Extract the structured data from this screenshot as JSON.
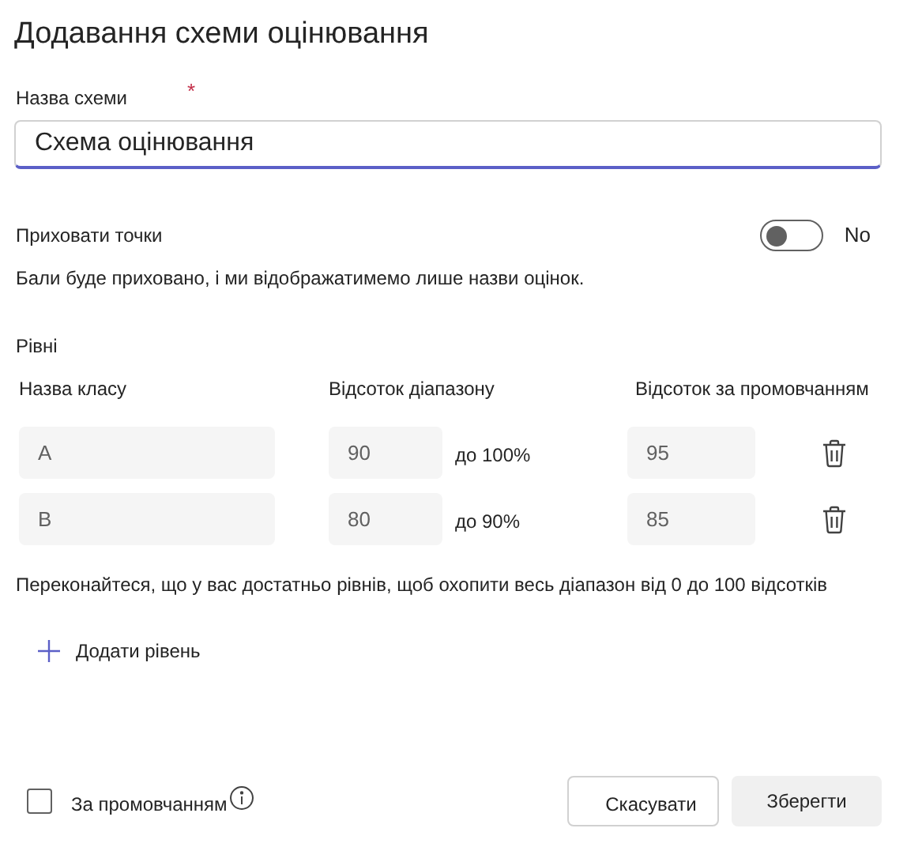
{
  "title": "Додавання схеми оцінювання",
  "scheme_name": {
    "label": "Назва схеми",
    "required_mark": "*",
    "value": "Схема оцінювання"
  },
  "hide_points": {
    "label": "Приховати точки",
    "on": false,
    "state_text": "No",
    "description": "Бали буде приховано, і ми відображатимемо лише назви оцінок."
  },
  "levels": {
    "label": "Рівні",
    "columns": [
      "Назва класу",
      "Відсоток діапазону",
      "Відсоток за промовчанням"
    ],
    "rows": [
      {
        "name": "A",
        "range_from": "90",
        "range_to": "до 100%",
        "default": "95"
      },
      {
        "name": "B",
        "range_from": "80",
        "range_to": "до 90%",
        "default": "85"
      }
    ],
    "note": "Переконайтеся, що у вас достатньо рівнів, щоб охопити весь діапазон від 0 до 100 відсотків",
    "add_button": "Додати рівень"
  },
  "default_checkbox": {
    "label": "За промовчанням",
    "checked": false
  },
  "buttons": [
    "Скасувати",
    "Зберегти"
  ]
}
